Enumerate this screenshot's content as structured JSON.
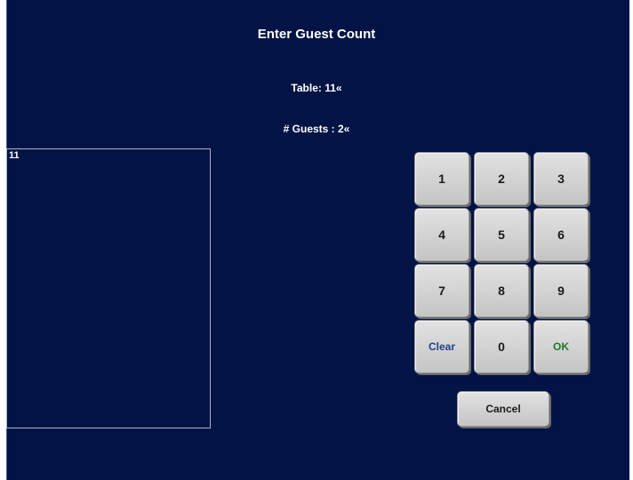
{
  "dialog": {
    "title": "Enter Guest Count",
    "table_line": "Table: 11«",
    "guests_line": "# Guests : 2«"
  },
  "table_list": {
    "items": [
      "11"
    ]
  },
  "keypad": {
    "keys": [
      "1",
      "2",
      "3",
      "4",
      "5",
      "6",
      "7",
      "8",
      "9",
      "Clear",
      "0",
      "OK"
    ],
    "cancel_label": "Cancel"
  },
  "colors": {
    "background": "#021445",
    "key_face": "#d4d4d4",
    "clear_text": "#21408a",
    "ok_text": "#1d7a26"
  }
}
